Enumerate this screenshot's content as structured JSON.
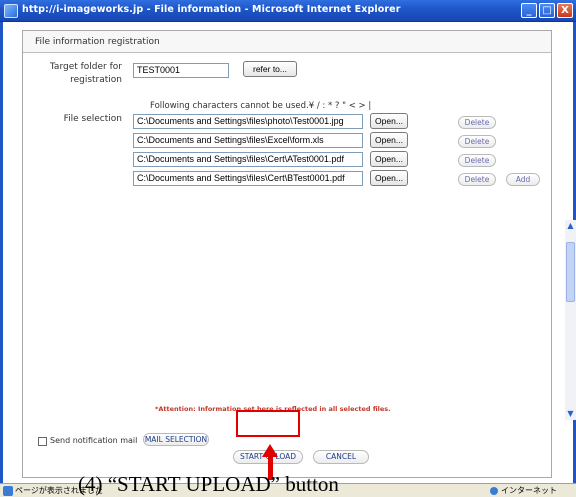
{
  "window": {
    "title": "http://i-imageworks.jp - File information - Microsoft Internet Explorer",
    "btn_min": "_",
    "btn_max": "□",
    "btn_close": "X"
  },
  "form": {
    "section_title": "File information registration",
    "target_folder_label_1": "Target folder for",
    "target_folder_label_2": "registration",
    "target_folder_value": "TEST0001",
    "refer_button": "refer to...",
    "chars_note": "Following characters cannot be used.¥ / : * ? \" < > |",
    "file_selection_label": "File selection",
    "files": [
      {
        "path": "C:\\Documents and Settings\\files\\photo\\Test0001.jpg",
        "open": "Open...",
        "delete": "Delete"
      },
      {
        "path": "C:\\Documents and Settings\\files\\Excel\\form.xls",
        "open": "Open...",
        "delete": "Delete"
      },
      {
        "path": "C:\\Documents and Settings\\files\\Cert\\ATest0001.pdf",
        "open": "Open...",
        "delete": "Delete"
      },
      {
        "path": "C:\\Documents and Settings\\files\\Cert\\BTest0001.pdf",
        "open": "Open...",
        "delete": "Delete"
      }
    ],
    "add_button": "Add"
  },
  "bottom": {
    "attention": "*Attention: Information set here is reflected in all selected files.",
    "notify_label": "Send notification mail",
    "mail_button": "MAIL SELECTION",
    "start_button": "START UPLOAD",
    "cancel_button": "CANCEL"
  },
  "statusbar": {
    "status_text": "ページが表示されました",
    "zone_text": "インターネット"
  },
  "caption": "(4) “START UPLOAD” button",
  "colors": {
    "titlebar": "#1e55c8",
    "highlight": "#e00000",
    "attention": "#c0392b"
  }
}
